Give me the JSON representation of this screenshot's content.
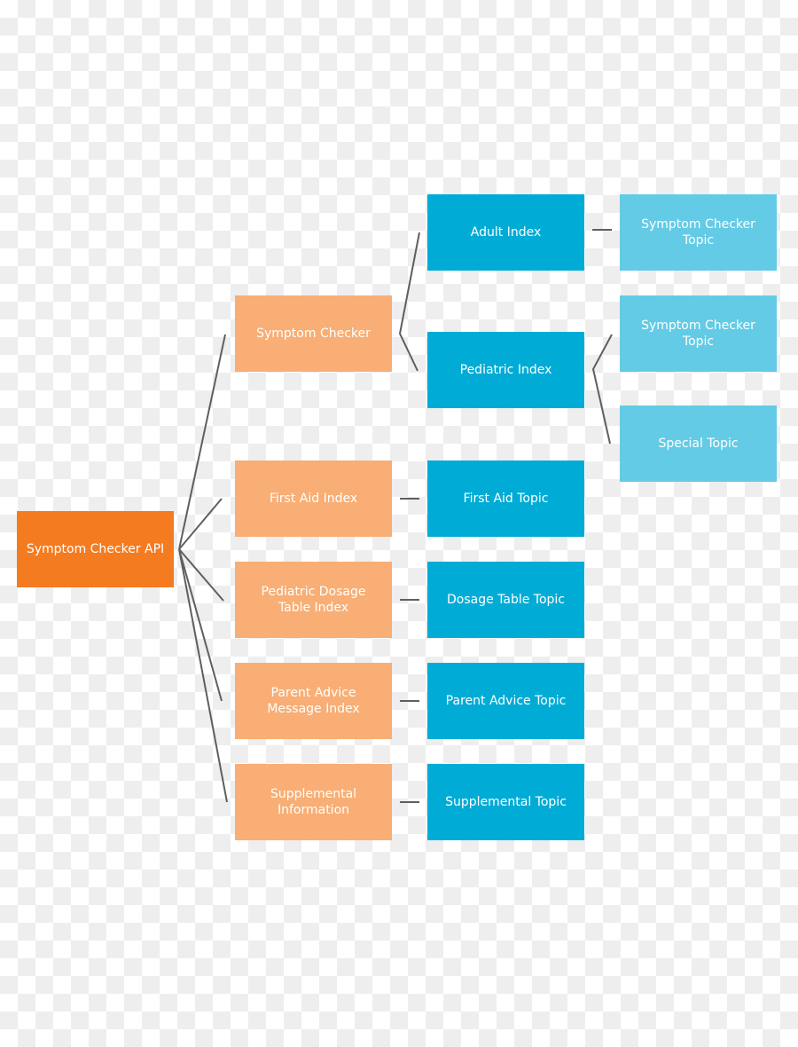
{
  "colors": {
    "root": "#f47b20",
    "level1": "#f8ae74",
    "level2": "#00acd6",
    "level3": "#63cbe6",
    "connector": "#5f5f5f"
  },
  "root": {
    "label": "Symptom Checker API"
  },
  "level1": [
    {
      "label": "Symptom Checker"
    },
    {
      "label": "First Aid Index"
    },
    {
      "label": "Pediatric Dosage Table Index"
    },
    {
      "label": "Parent Advice Message Index"
    },
    {
      "label": "Supplemental Information"
    }
  ],
  "level2": [
    {
      "label": "Adult Index"
    },
    {
      "label": "Pediatric Index"
    },
    {
      "label": "First Aid Topic"
    },
    {
      "label": "Dosage Table Topic"
    },
    {
      "label": "Parent Advice Topic"
    },
    {
      "label": "Supplemental Topic"
    }
  ],
  "level3": [
    {
      "label": "Symptom Checker Topic"
    },
    {
      "label": "Symptom Checker Topic"
    },
    {
      "label": "Special Topic"
    }
  ]
}
